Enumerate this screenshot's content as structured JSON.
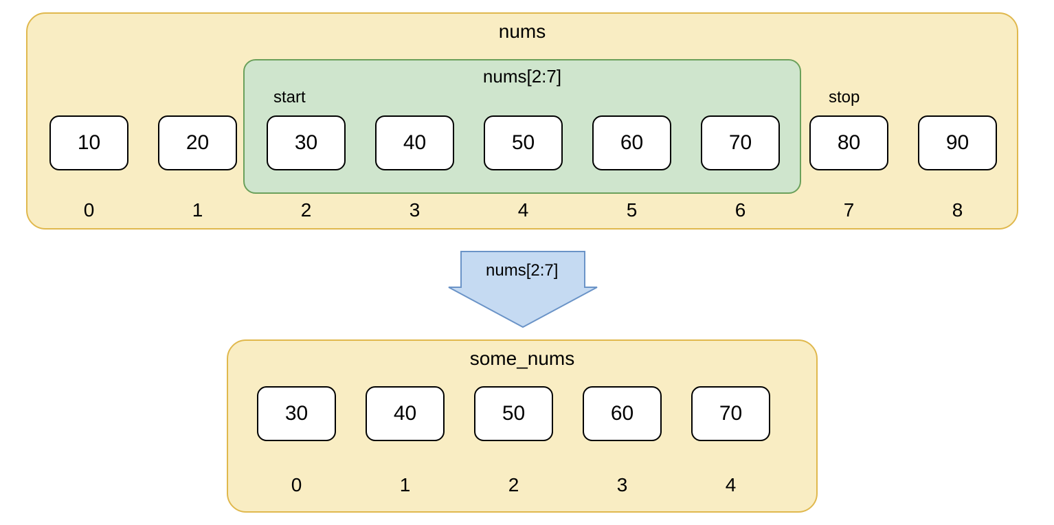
{
  "source_list": {
    "name": "nums",
    "slice_label": "nums[2:7]",
    "start_label": "start",
    "stop_label": "stop",
    "values": [
      "10",
      "20",
      "30",
      "40",
      "50",
      "60",
      "70",
      "80",
      "90"
    ],
    "indices": [
      "0",
      "1",
      "2",
      "3",
      "4",
      "5",
      "6",
      "7",
      "8"
    ],
    "slice_start_index": 2,
    "slice_end_index_exclusive": 7
  },
  "arrow": {
    "label": "nums[2:7]"
  },
  "result_list": {
    "name": "some_nums",
    "values": [
      "30",
      "40",
      "50",
      "60",
      "70"
    ],
    "indices": [
      "0",
      "1",
      "2",
      "3",
      "4"
    ]
  },
  "colors": {
    "outer_fill": "#f9edc3",
    "outer_stroke": "#e0b84d",
    "inner_fill": "#cfe5cd",
    "inner_stroke": "#6aa05a",
    "arrow_fill": "#c5daf2",
    "arrow_stroke": "#6a93c7"
  }
}
